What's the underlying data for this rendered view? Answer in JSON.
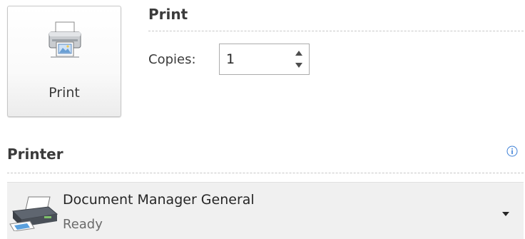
{
  "print": {
    "button_label": "Print",
    "section_title": "Print",
    "copies_label": "Copies:",
    "copies_value": "1"
  },
  "printer": {
    "section_title": "Printer",
    "selected_name": "Document Manager General",
    "selected_status": "Ready"
  },
  "icons": {
    "print_button": "printer-icon",
    "copies_up": "spin-up-arrow-icon",
    "copies_down": "spin-down-arrow-icon",
    "info": "info-icon",
    "printer_device": "printer-device-icon",
    "dropdown": "chevron-down-icon"
  },
  "colors": {
    "info_accent": "#3c7fd6",
    "select_background": "#f0f0f0",
    "rule": "#c8c8c8"
  }
}
